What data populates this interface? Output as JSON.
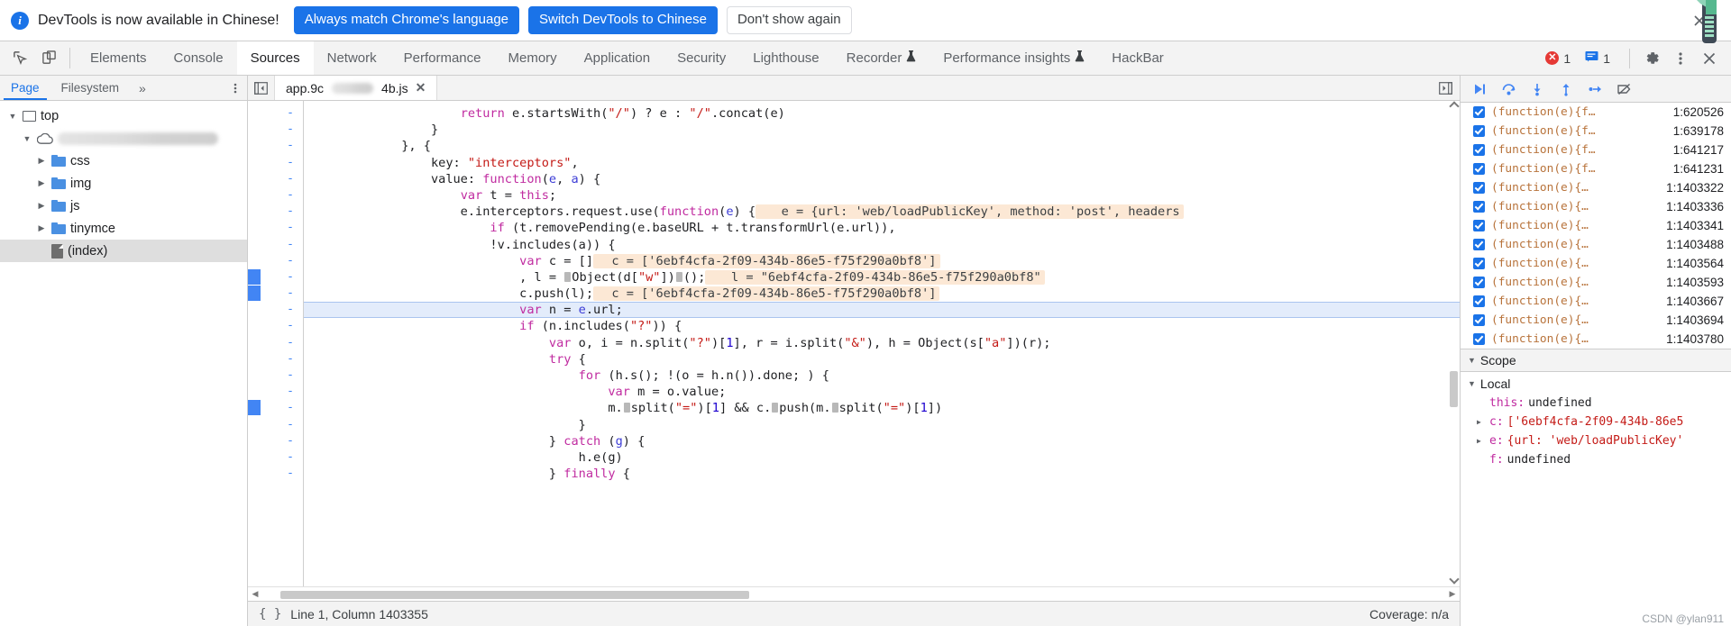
{
  "banner": {
    "info_icon": "info-icon",
    "message": "DevTools is now available in Chinese!",
    "primary_button": "Always match Chrome's language",
    "secondary_button": "Switch DevTools to Chinese",
    "dismiss_button": "Don't show again",
    "close_icon": "close-icon",
    "accent_color": "#1a73e8"
  },
  "toolbar": {
    "inspect_icon": "inspect-element-icon",
    "device_icon": "device-toolbar-icon",
    "tabs": [
      {
        "label": "Elements",
        "active": false,
        "icon": null
      },
      {
        "label": "Console",
        "active": false,
        "icon": null
      },
      {
        "label": "Sources",
        "active": true,
        "icon": null
      },
      {
        "label": "Network",
        "active": false,
        "icon": null
      },
      {
        "label": "Performance",
        "active": false,
        "icon": null
      },
      {
        "label": "Memory",
        "active": false,
        "icon": null
      },
      {
        "label": "Application",
        "active": false,
        "icon": null
      },
      {
        "label": "Security",
        "active": false,
        "icon": null
      },
      {
        "label": "Lighthouse",
        "active": false,
        "icon": null
      },
      {
        "label": "Recorder",
        "active": false,
        "icon": "beaker-icon"
      },
      {
        "label": "Performance insights",
        "active": false,
        "icon": "beaker-icon"
      },
      {
        "label": "HackBar",
        "active": false,
        "icon": null
      }
    ],
    "error_badge": {
      "icon": "error-icon",
      "count": "1",
      "color": "#e53935"
    },
    "message_badge": {
      "icon": "message-icon",
      "count": "1",
      "color": "#1a73e8"
    },
    "settings_icon": "gear-icon",
    "more_icon": "kebab-menu-icon",
    "close_icon": "close-icon"
  },
  "navigator": {
    "tabs": [
      {
        "label": "Page",
        "active": true
      },
      {
        "label": "Filesystem",
        "active": false
      }
    ],
    "more_tabs_icon": "chevron-double-right-icon",
    "kebab_icon": "kebab-menu-icon",
    "tree": [
      {
        "label": "top",
        "icon": "frame-icon",
        "indent": 0,
        "expanded": true,
        "selected": false
      },
      {
        "label": "",
        "icon": "cloud-icon",
        "indent": 1,
        "expanded": true,
        "selected": false,
        "redacted": true
      },
      {
        "label": "css",
        "icon": "folder-icon",
        "indent": 2,
        "expanded": false,
        "selected": false
      },
      {
        "label": "img",
        "icon": "folder-icon",
        "indent": 2,
        "expanded": false,
        "selected": false
      },
      {
        "label": "js",
        "icon": "folder-icon",
        "indent": 2,
        "expanded": false,
        "selected": false
      },
      {
        "label": "tinymce",
        "icon": "folder-icon",
        "indent": 2,
        "expanded": false,
        "selected": false
      },
      {
        "label": "(index)",
        "icon": "document-icon",
        "indent": 2,
        "expanded": null,
        "selected": true
      }
    ]
  },
  "editor": {
    "panel_toggle_icon": "show-navigator-icon",
    "tab_label_prefix": "app.9c",
    "tab_label_suffix": "4b.js",
    "tab_close_icon": "close-icon",
    "more_panel_icon": "show-debugger-icon",
    "gutter_marker": "-",
    "code_lines": [
      {
        "breakpoint": false,
        "exec": false,
        "tokens": [
          {
            "t": "                    ",
            "c": ""
          },
          {
            "t": "return",
            "c": "kw"
          },
          {
            "t": " e.startsWith(",
            "c": ""
          },
          {
            "t": "\"/\"",
            "c": "str"
          },
          {
            "t": ") ? e : ",
            "c": ""
          },
          {
            "t": "\"/\"",
            "c": "str"
          },
          {
            "t": ".concat(e)",
            "c": ""
          }
        ]
      },
      {
        "breakpoint": false,
        "exec": false,
        "tokens": [
          {
            "t": "                }",
            "c": ""
          }
        ]
      },
      {
        "breakpoint": false,
        "exec": false,
        "tokens": [
          {
            "t": "            }, {",
            "c": ""
          }
        ]
      },
      {
        "breakpoint": false,
        "exec": false,
        "tokens": [
          {
            "t": "                key: ",
            "c": ""
          },
          {
            "t": "\"interceptors\"",
            "c": "str"
          },
          {
            "t": ",",
            "c": ""
          }
        ]
      },
      {
        "breakpoint": false,
        "exec": false,
        "tokens": [
          {
            "t": "                value: ",
            "c": ""
          },
          {
            "t": "function",
            "c": "kw"
          },
          {
            "t": "(",
            "c": ""
          },
          {
            "t": "e",
            "c": "prm"
          },
          {
            "t": ", ",
            "c": ""
          },
          {
            "t": "a",
            "c": "prm"
          },
          {
            "t": ") {",
            "c": ""
          }
        ]
      },
      {
        "breakpoint": false,
        "exec": false,
        "tokens": [
          {
            "t": "                    ",
            "c": ""
          },
          {
            "t": "var",
            "c": "kw"
          },
          {
            "t": " t = ",
            "c": ""
          },
          {
            "t": "this",
            "c": "kw"
          },
          {
            "t": ";",
            "c": ""
          }
        ]
      },
      {
        "breakpoint": false,
        "exec": false,
        "tokens": [
          {
            "t": "                    e.interceptors.request.use(",
            "c": ""
          },
          {
            "t": "function",
            "c": "kw"
          },
          {
            "t": "(",
            "c": ""
          },
          {
            "t": "e",
            "c": "prm"
          },
          {
            "t": ") {",
            "c": ""
          },
          {
            "t": "   e = {url: 'web/loadPublicKey', method: 'post', headers",
            "c": "pill"
          }
        ]
      },
      {
        "breakpoint": false,
        "exec": false,
        "tokens": [
          {
            "t": "                        ",
            "c": ""
          },
          {
            "t": "if",
            "c": "kw"
          },
          {
            "t": " (t.removePending(e.baseURL + t.transformUrl(e.url)),",
            "c": ""
          }
        ]
      },
      {
        "breakpoint": false,
        "exec": false,
        "tokens": [
          {
            "t": "                        !v.includes(a)) {",
            "c": ""
          }
        ]
      },
      {
        "breakpoint": false,
        "exec": false,
        "tokens": [
          {
            "t": "                            ",
            "c": ""
          },
          {
            "t": "var",
            "c": "kw"
          },
          {
            "t": " c = []",
            "c": ""
          },
          {
            "t": "  c = ['6ebf4cfa-2f09-434b-86e5-f75f290a0bf8']",
            "c": "pill"
          }
        ]
      },
      {
        "breakpoint": true,
        "exec": false,
        "tokens": [
          {
            "t": "                            , l = ",
            "c": ""
          },
          {
            "t": "D",
            "c": "box"
          },
          {
            "t": "Object(d[",
            "c": ""
          },
          {
            "t": "\"w\"",
            "c": "str"
          },
          {
            "t": "])",
            "c": ""
          },
          {
            "t": "D",
            "c": "box"
          },
          {
            "t": "();",
            "c": ""
          },
          {
            "t": "   l = \"6ebf4cfa-2f09-434b-86e5-f75f290a0bf8\"",
            "c": "pill"
          }
        ]
      },
      {
        "breakpoint": true,
        "exec": false,
        "tokens": [
          {
            "t": "                            c.push(l);",
            "c": ""
          },
          {
            "t": "  c = ['6ebf4cfa-2f09-434b-86e5-f75f290a0bf8']",
            "c": "pill"
          }
        ]
      },
      {
        "breakpoint": false,
        "exec": true,
        "tokens": [
          {
            "t": "                            ",
            "c": ""
          },
          {
            "t": "var",
            "c": "kw"
          },
          {
            "t": " n = ",
            "c": ""
          },
          {
            "t": "e",
            "c": "prm"
          },
          {
            "t": ".url;",
            "c": ""
          }
        ]
      },
      {
        "breakpoint": false,
        "exec": false,
        "tokens": [
          {
            "t": "                            ",
            "c": ""
          },
          {
            "t": "if",
            "c": "kw"
          },
          {
            "t": " (n.includes(",
            "c": ""
          },
          {
            "t": "\"?\"",
            "c": "str"
          },
          {
            "t": ")) {",
            "c": ""
          }
        ]
      },
      {
        "breakpoint": false,
        "exec": false,
        "tokens": [
          {
            "t": "                                ",
            "c": ""
          },
          {
            "t": "var",
            "c": "kw"
          },
          {
            "t": " o, i = n.split(",
            "c": ""
          },
          {
            "t": "\"?\"",
            "c": "str"
          },
          {
            "t": ")[",
            "c": ""
          },
          {
            "t": "1",
            "c": "num"
          },
          {
            "t": "], r = i.split(",
            "c": ""
          },
          {
            "t": "\"&\"",
            "c": "str"
          },
          {
            "t": "), h = Object(s[",
            "c": ""
          },
          {
            "t": "\"a\"",
            "c": "str"
          },
          {
            "t": "])(r);",
            "c": ""
          }
        ]
      },
      {
        "breakpoint": false,
        "exec": false,
        "tokens": [
          {
            "t": "                                ",
            "c": ""
          },
          {
            "t": "try",
            "c": "kw"
          },
          {
            "t": " {",
            "c": ""
          }
        ]
      },
      {
        "breakpoint": false,
        "exec": false,
        "tokens": [
          {
            "t": "                                    ",
            "c": ""
          },
          {
            "t": "for",
            "c": "kw"
          },
          {
            "t": " (h.s(); !(o = h.n()).done; ) {",
            "c": ""
          }
        ]
      },
      {
        "breakpoint": false,
        "exec": false,
        "tokens": [
          {
            "t": "                                        ",
            "c": ""
          },
          {
            "t": "var",
            "c": "kw"
          },
          {
            "t": " m = o.value;",
            "c": ""
          }
        ]
      },
      {
        "breakpoint": true,
        "exec": false,
        "tokens": [
          {
            "t": "                                        m.",
            "c": ""
          },
          {
            "t": "D",
            "c": "box"
          },
          {
            "t": "split(",
            "c": ""
          },
          {
            "t": "\"=\"",
            "c": "str"
          },
          {
            "t": ")[",
            "c": ""
          },
          {
            "t": "1",
            "c": "num"
          },
          {
            "t": "] && c.",
            "c": ""
          },
          {
            "t": "D",
            "c": "box"
          },
          {
            "t": "push(m.",
            "c": ""
          },
          {
            "t": "D",
            "c": "box"
          },
          {
            "t": "split(",
            "c": ""
          },
          {
            "t": "\"=\"",
            "c": "str"
          },
          {
            "t": ")[",
            "c": ""
          },
          {
            "t": "1",
            "c": "num"
          },
          {
            "t": "])",
            "c": ""
          }
        ]
      },
      {
        "breakpoint": false,
        "exec": false,
        "tokens": [
          {
            "t": "                                    }",
            "c": ""
          }
        ]
      },
      {
        "breakpoint": false,
        "exec": false,
        "tokens": [
          {
            "t": "                                } ",
            "c": ""
          },
          {
            "t": "catch",
            "c": "kw"
          },
          {
            "t": " (",
            "c": ""
          },
          {
            "t": "g",
            "c": "prm"
          },
          {
            "t": ") {",
            "c": ""
          }
        ]
      },
      {
        "breakpoint": false,
        "exec": false,
        "tokens": [
          {
            "t": "                                    h.e(g)",
            "c": ""
          }
        ]
      },
      {
        "breakpoint": false,
        "exec": false,
        "tokens": [
          {
            "t": "                                } ",
            "c": ""
          },
          {
            "t": "finally",
            "c": "kw"
          },
          {
            "t": " {",
            "c": ""
          }
        ]
      }
    ],
    "statusbar": {
      "pretty_print_icon": "pretty-print-icon",
      "position": "Line 1, Column 1403355",
      "coverage": "Coverage: n/a"
    }
  },
  "debugger": {
    "controls": [
      {
        "name": "resume-script-execution",
        "icon": "resume-icon"
      },
      {
        "name": "step-over-next-function-call",
        "icon": "step-over-icon"
      },
      {
        "name": "step-into-next-function-call",
        "icon": "step-into-icon"
      },
      {
        "name": "step-out-of-current-function",
        "icon": "step-out-icon"
      },
      {
        "name": "step",
        "icon": "step-icon"
      },
      {
        "name": "deactivate-breakpoints",
        "icon": "deactivate-breakpoints-icon"
      }
    ],
    "breakpoints": [
      {
        "checked": true,
        "label": "(function(e){f…",
        "location": "1:620526"
      },
      {
        "checked": true,
        "label": "(function(e){f…",
        "location": "1:639178"
      },
      {
        "checked": true,
        "label": "(function(e){f…",
        "location": "1:641217"
      },
      {
        "checked": true,
        "label": "(function(e){f…",
        "location": "1:641231"
      },
      {
        "checked": true,
        "label": "(function(e){…",
        "location": "1:1403322"
      },
      {
        "checked": true,
        "label": "(function(e){…",
        "location": "1:1403336"
      },
      {
        "checked": true,
        "label": "(function(e){…",
        "location": "1:1403341"
      },
      {
        "checked": true,
        "label": "(function(e){…",
        "location": "1:1403488"
      },
      {
        "checked": true,
        "label": "(function(e){…",
        "location": "1:1403564"
      },
      {
        "checked": true,
        "label": "(function(e){…",
        "location": "1:1403593"
      },
      {
        "checked": true,
        "label": "(function(e){…",
        "location": "1:1403667"
      },
      {
        "checked": true,
        "label": "(function(e){…",
        "location": "1:1403694"
      },
      {
        "checked": true,
        "label": "(function(e){…",
        "location": "1:1403780"
      }
    ],
    "scope_section": {
      "title": "Scope",
      "expanded": true
    },
    "local_title": "Local",
    "scope_vars": [
      {
        "expandable": false,
        "key": "this:",
        "value": " undefined",
        "value_type": "plain"
      },
      {
        "expandable": true,
        "key": "c:",
        "value": " ['6ebf4cfa-2f09-434b-86e5",
        "value_type": "string"
      },
      {
        "expandable": true,
        "key": "e:",
        "value": " {url: 'web/loadPublicKey'",
        "value_type": "string"
      },
      {
        "expandable": false,
        "key": "f:",
        "value": " undefined",
        "value_type": "plain"
      }
    ]
  },
  "watermark": "CSDN @ylan911"
}
